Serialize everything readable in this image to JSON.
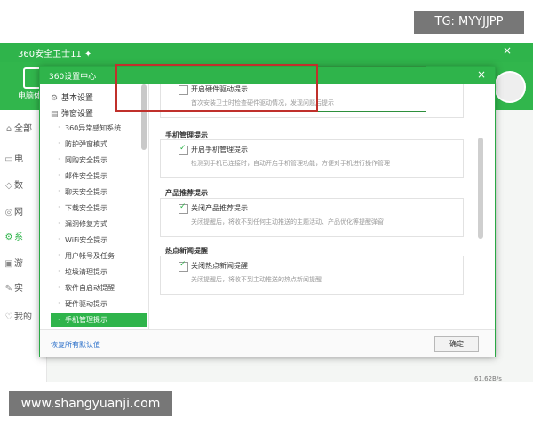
{
  "watermark_top": "TG: MYYJJPP",
  "watermark_bottom": "www.shangyuanji.com",
  "background_app": {
    "title": "360安全卫士11 ✦",
    "header_label": "电脑体",
    "side_items": [
      {
        "label": "全部",
        "icon": "home-icon"
      },
      {
        "label": "电",
        "icon": "monitor-icon"
      },
      {
        "label": "数",
        "icon": "shield-icon"
      },
      {
        "label": "网",
        "icon": "globe-icon"
      },
      {
        "label": "系",
        "icon": "gear-icon"
      },
      {
        "label": "游",
        "icon": "gamepad-icon"
      },
      {
        "label": "实",
        "icon": "tools-icon"
      },
      {
        "label": "我的",
        "icon": "heart-icon"
      }
    ],
    "status_text": "61.62B/s"
  },
  "dialog": {
    "title": "360设置中心",
    "close": "×",
    "nav": {
      "groups": [
        {
          "label": "基本设置",
          "icon": "gear-icon"
        },
        {
          "label": "弹窗设置",
          "icon": "window-icon"
        }
      ],
      "items": [
        "360异常感知系统",
        "防护弹窗模式",
        "网购安全提示",
        "邮件安全提示",
        "聊天安全提示",
        "下载安全提示",
        "漏洞修复方式",
        "WiFi安全提示",
        "用户帐号及任务",
        "垃圾清理提示",
        "软件自启动提醒",
        "硬件驱动提示",
        "手机管理提示"
      ],
      "active_index": 12
    },
    "sections": [
      {
        "title": "",
        "option_label": "开启硬件驱动提示",
        "option_desc": "首次安装卫士时检查硬件驱动情况，发现问题后提示",
        "checked": false
      },
      {
        "title": "手机管理提示",
        "option_label": "开启手机管理提示",
        "option_desc": "检测到手机已连接时，自动开启手机管理功能，方便对手机进行操作管理",
        "checked": true
      },
      {
        "title": "产品推荐提示",
        "option_label": "关闭产品推荐提示",
        "option_desc": "关闭提醒后，将收不到任何主动推送的主题活动、产品优化等提醒弹窗",
        "checked": true
      },
      {
        "title": "热点新闻提醒",
        "option_label": "关闭热点新闻提醒",
        "option_desc": "关闭提醒后，将收不到主动推送的热点新闻提醒",
        "checked": true
      }
    ],
    "footer": {
      "restore_label": "恢复所有默认值",
      "ok_label": "确定"
    }
  },
  "colors": {
    "brand_green": "#2fb44b",
    "highlight_red": "#c0302b",
    "link_blue": "#2a6fc9"
  }
}
